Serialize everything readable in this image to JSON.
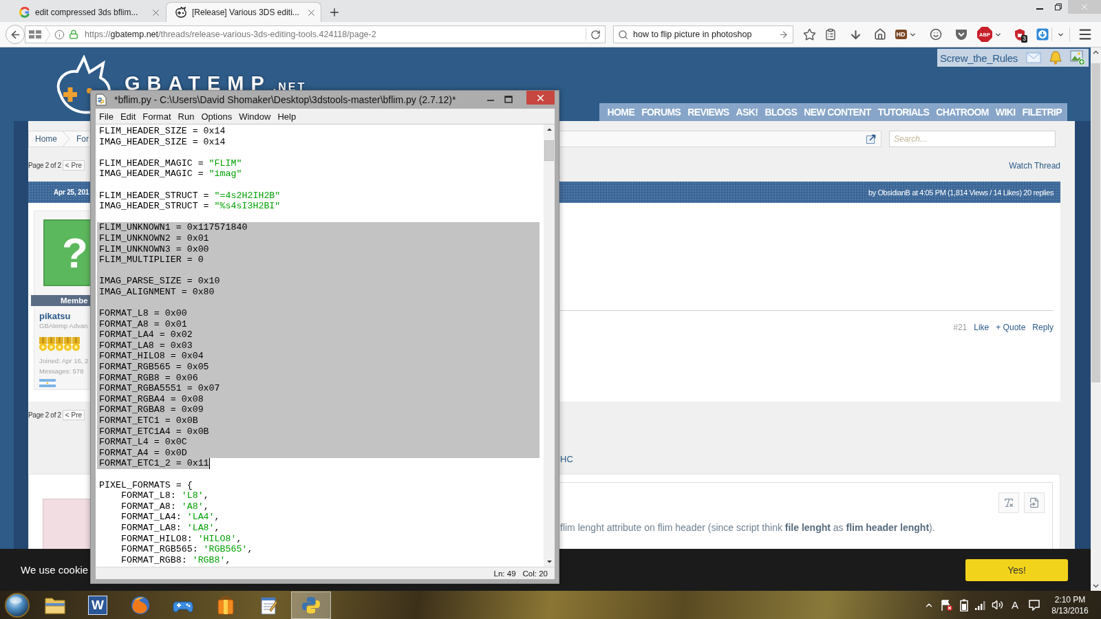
{
  "browser": {
    "tabs": [
      {
        "title": "edit compressed 3ds bflim...",
        "selected": false
      },
      {
        "title": "[Release] Various 3DS editi...",
        "selected": true
      }
    ],
    "address": {
      "scheme": "https://",
      "host": "gbatemp.net",
      "path": "/threads/release-various-3ds-editing-tools.424118/page-2"
    },
    "search": {
      "value": "how to flip picture in photoshop"
    },
    "toolbar": {
      "hd_label": "HD",
      "abp_label": "ABP",
      "shield_badge": "3"
    }
  },
  "site_header": {
    "logo": {
      "name": "GBATEMP",
      "suffix": ".NET"
    },
    "username": "Screw_the_Rules",
    "nav": [
      "HOME",
      "FORUMS",
      "REVIEWS",
      "ASK!",
      "BLOGS",
      "NEW CONTENT",
      "TUTORIALS",
      "CHATROOM",
      "WIKI",
      "FILETRIP"
    ]
  },
  "thread": {
    "breadcrumb": [
      "Home",
      "For"
    ],
    "search": {
      "placeholder": "Search..."
    },
    "top_pagination": {
      "label": "Page 2 of 2",
      "prev": "< Pre"
    },
    "watch": "Watch Thread",
    "post": {
      "date": "Apr 25, 201",
      "meta": "by ObsidianB at 4:05 PM (1,814 Views / 14 Likes) 20 replies",
      "author": {
        "avatar_glyph": "?",
        "ribbon": "Membe",
        "name": "pikatsu",
        "title": "GBAtemp Advan",
        "stars": 5,
        "joined": "Joined: Apr 16, 2",
        "messages": "Messages: 578"
      },
      "number": "#21",
      "actions": [
        "Like",
        "+ Quote",
        "Reply"
      ]
    },
    "bottom_pagination": {
      "label": "Page 2 of 2",
      "prev": "< Pre"
    },
    "link_fragment": "HC",
    "reply": {
      "text": "flim lenght attribute on flim header (since script think **file lenght** as **flim header lenght**)."
    }
  },
  "cookie_notice": {
    "text": "We use cookie",
    "button": "Yes!"
  },
  "idle_window": {
    "title": "*bflim.py - C:\\Users\\David Shomaker\\Desktop\\3dstools-master\\bflim.py (2.7.12)*",
    "menu": [
      "File",
      "Edit",
      "Format",
      "Run",
      "Options",
      "Window",
      "Help"
    ],
    "lines": [
      {
        "kind": "code",
        "text": "FLIM_HEADER_SIZE = 0x14",
        "selected": false,
        "cursor": false
      },
      {
        "kind": "code",
        "text": "IMAG_HEADER_SIZE = 0x14",
        "selected": false,
        "cursor": false
      },
      {
        "kind": "blank",
        "selected": false,
        "cursor": false
      },
      {
        "kind": "code",
        "text": "FLIM_HEADER_MAGIC = \"FLIM\"",
        "selected": false,
        "cursor": false
      },
      {
        "kind": "code",
        "text": "IMAG_HEADER_MAGIC = \"imag\"",
        "selected": false,
        "cursor": false
      },
      {
        "kind": "blank",
        "selected": false,
        "cursor": false
      },
      {
        "kind": "code",
        "text": "FLIM_HEADER_STRUCT = \"=4s2H2IH2B\"",
        "selected": false,
        "cursor": false
      },
      {
        "kind": "code",
        "text": "IMAG_HEADER_STRUCT = \"%s4sI3H2BI\"",
        "selected": false,
        "cursor": false
      },
      {
        "kind": "blank",
        "selected": false,
        "cursor": false
      },
      {
        "kind": "code",
        "text": "FLIM_UNKNOWN1 = 0x117571840",
        "selected": true,
        "cursor": false
      },
      {
        "kind": "code",
        "text": "FLIM_UNKNOWN2 = 0x01",
        "selected": true,
        "cursor": false
      },
      {
        "kind": "code",
        "text": "FLIM_UNKNOWN3 = 0x00",
        "selected": true,
        "cursor": false
      },
      {
        "kind": "code",
        "text": "FLIM_MULTIPLIER = 0",
        "selected": true,
        "cursor": false
      },
      {
        "kind": "blank",
        "selected": true,
        "cursor": false
      },
      {
        "kind": "code",
        "text": "IMAG_PARSE_SIZE = 0x10",
        "selected": true,
        "cursor": false
      },
      {
        "kind": "code",
        "text": "IMAG_ALIGNMENT = 0x80",
        "selected": true,
        "cursor": false
      },
      {
        "kind": "blank",
        "selected": true,
        "cursor": false
      },
      {
        "kind": "code",
        "text": "FORMAT_L8 = 0x00",
        "selected": true,
        "cursor": false
      },
      {
        "kind": "code",
        "text": "FORMAT_A8 = 0x01",
        "selected": true,
        "cursor": false
      },
      {
        "kind": "code",
        "text": "FORMAT_LA4 = 0x02",
        "selected": true,
        "cursor": false
      },
      {
        "kind": "code",
        "text": "FORMAT_LA8 = 0x03",
        "selected": true,
        "cursor": false
      },
      {
        "kind": "code",
        "text": "FORMAT_HILO8 = 0x04",
        "selected": true,
        "cursor": false
      },
      {
        "kind": "code",
        "text": "FORMAT_RGB565 = 0x05",
        "selected": true,
        "cursor": false
      },
      {
        "kind": "code",
        "text": "FORMAT_RGB8 = 0x06",
        "selected": true,
        "cursor": false
      },
      {
        "kind": "code",
        "text": "FORMAT_RGBA5551 = 0x07",
        "selected": true,
        "cursor": false
      },
      {
        "kind": "code",
        "text": "FORMAT_RGBA4 = 0x08",
        "selected": true,
        "cursor": false
      },
      {
        "kind": "code",
        "text": "FORMAT_RGBA8 = 0x09",
        "selected": true,
        "cursor": false
      },
      {
        "kind": "code",
        "text": "FORMAT_ETC1 = 0x0B",
        "selected": true,
        "cursor": false
      },
      {
        "kind": "code",
        "text": "FORMAT_ETC1A4 = 0x0B",
        "selected": true,
        "cursor": false
      },
      {
        "kind": "code",
        "text": "FORMAT_L4 = 0x0C",
        "selected": true,
        "cursor": false
      },
      {
        "kind": "code",
        "text": "FORMAT_A4 = 0x0D",
        "selected": true,
        "cursor": false
      },
      {
        "kind": "code",
        "text": "FORMAT_ETC1_2 = 0x11",
        "selected": true,
        "cursor": true
      },
      {
        "kind": "blank",
        "selected": false,
        "cursor": false
      },
      {
        "kind": "code",
        "text": "PIXEL_FORMATS = {",
        "selected": false,
        "cursor": false
      },
      {
        "kind": "code",
        "text": "    FORMAT_L8: 'L8',",
        "selected": false,
        "cursor": false
      },
      {
        "kind": "code",
        "text": "    FORMAT_A8: 'A8',",
        "selected": false,
        "cursor": false
      },
      {
        "kind": "code",
        "text": "    FORMAT_LA4: 'LA4',",
        "selected": false,
        "cursor": false
      },
      {
        "kind": "code",
        "text": "    FORMAT_LA8: 'LA8',",
        "selected": false,
        "cursor": false
      },
      {
        "kind": "code",
        "text": "    FORMAT_HILO8: 'HILO8',",
        "selected": false,
        "cursor": false
      },
      {
        "kind": "code",
        "text": "    FORMAT_RGB565: 'RGB565',",
        "selected": false,
        "cursor": false
      },
      {
        "kind": "code",
        "text": "    FORMAT_RGB8: 'RGB8',",
        "selected": false,
        "cursor": false
      }
    ],
    "status": {
      "line": "Ln: 49",
      "column": "Col: 20"
    }
  },
  "taskbar": {
    "apps": [
      {
        "selected": false
      },
      {
        "selected": false,
        "letter": "W"
      },
      {
        "selected": false
      },
      {
        "selected": false
      },
      {
        "selected": false
      },
      {
        "selected": false
      },
      {
        "selected": true
      }
    ],
    "input_indicator": "A",
    "time": "2:10 PM",
    "date": "8/13/2016"
  }
}
